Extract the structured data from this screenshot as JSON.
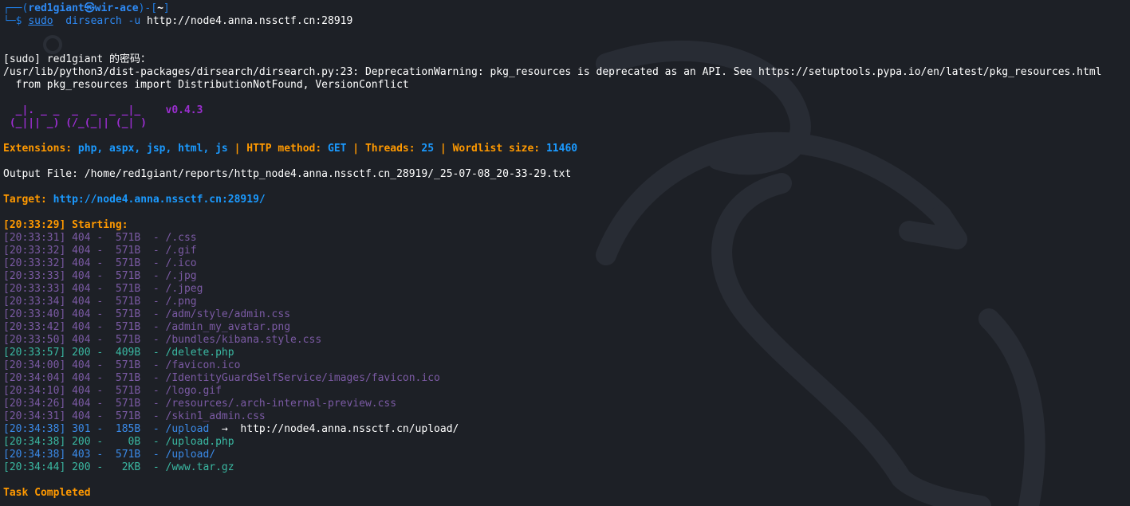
{
  "prompt": {
    "open": "┌──(",
    "user": "red1giant",
    "at": "㉿",
    "host": "wir-ace",
    "mid": ")-[",
    "dir": "~",
    "close": "]",
    "dollar": "└─$ ",
    "sudo": "sudo",
    "cmd": "  dirsearch",
    "flag": " -u ",
    "url": "http://node4.anna.nssctf.cn:28919"
  },
  "sudo_prompt": "[sudo] red1giant 的密码：",
  "warning_line1": "/usr/lib/python3/dist-packages/dirsearch/dirsearch.py:23: DeprecationWarning: pkg_resources is deprecated as an API. See https://setuptools.pypa.io/en/latest/pkg_resources.html",
  "warning_line2": "  from pkg_resources import DistributionNotFound, VersionConflict",
  "banner": {
    "line1": "  _|. _ _  _  _  _ _|_    v0.4.3",
    "line2": " (_||| _) (/_(_|| (_| )"
  },
  "config": {
    "ext_label": "Extensions: ",
    "ext_value": "php, aspx, jsp, html, js",
    "sep1": " | ",
    "method_label": "HTTP method: ",
    "method_value": "GET",
    "sep2": " | ",
    "threads_label": "Threads: ",
    "threads_value": "25",
    "sep3": " | ",
    "wordlist_label": "Wordlist size: ",
    "wordlist_value": "11460"
  },
  "output_file": "Output File: /home/red1giant/reports/http_node4.anna.nssctf.cn_28919/_25-07-08_20-33-29.txt",
  "target": {
    "label": "Target: ",
    "url": "http://node4.anna.nssctf.cn:28919/"
  },
  "starting": "[20:33:29] Starting:",
  "results": [
    {
      "time": "[20:33:31]",
      "code": "404",
      "size": "571B",
      "path": "/.css",
      "kind": "404",
      "redirect": ""
    },
    {
      "time": "[20:33:32]",
      "code": "404",
      "size": "571B",
      "path": "/.gif",
      "kind": "404",
      "redirect": ""
    },
    {
      "time": "[20:33:32]",
      "code": "404",
      "size": "571B",
      "path": "/.ico",
      "kind": "404",
      "redirect": ""
    },
    {
      "time": "[20:33:33]",
      "code": "404",
      "size": "571B",
      "path": "/.jpg",
      "kind": "404",
      "redirect": ""
    },
    {
      "time": "[20:33:33]",
      "code": "404",
      "size": "571B",
      "path": "/.jpeg",
      "kind": "404",
      "redirect": ""
    },
    {
      "time": "[20:33:34]",
      "code": "404",
      "size": "571B",
      "path": "/.png",
      "kind": "404",
      "redirect": ""
    },
    {
      "time": "[20:33:40]",
      "code": "404",
      "size": "571B",
      "path": "/adm/style/admin.css",
      "kind": "404",
      "redirect": ""
    },
    {
      "time": "[20:33:42]",
      "code": "404",
      "size": "571B",
      "path": "/admin_my_avatar.png",
      "kind": "404",
      "redirect": ""
    },
    {
      "time": "[20:33:50]",
      "code": "404",
      "size": "571B",
      "path": "/bundles/kibana.style.css",
      "kind": "404",
      "redirect": ""
    },
    {
      "time": "[20:33:57]",
      "code": "200",
      "size": "409B",
      "path": "/delete.php",
      "kind": "200",
      "redirect": ""
    },
    {
      "time": "[20:34:00]",
      "code": "404",
      "size": "571B",
      "path": "/favicon.ico",
      "kind": "404",
      "redirect": ""
    },
    {
      "time": "[20:34:04]",
      "code": "404",
      "size": "571B",
      "path": "/IdentityGuardSelfService/images/favicon.ico",
      "kind": "404",
      "redirect": ""
    },
    {
      "time": "[20:34:10]",
      "code": "404",
      "size": "571B",
      "path": "/logo.gif",
      "kind": "404",
      "redirect": ""
    },
    {
      "time": "[20:34:26]",
      "code": "404",
      "size": "571B",
      "path": "/resources/.arch-internal-preview.css",
      "kind": "404",
      "redirect": ""
    },
    {
      "time": "[20:34:31]",
      "code": "404",
      "size": "571B",
      "path": "/skin1_admin.css",
      "kind": "404",
      "redirect": ""
    },
    {
      "time": "[20:34:38]",
      "code": "301",
      "size": "185B",
      "path": "/upload",
      "kind": "301",
      "redirect": "  ->  http://node4.anna.nssctf.cn/upload/"
    },
    {
      "time": "[20:34:38]",
      "code": "200",
      "size": "0B",
      "path": "/upload.php",
      "kind": "200",
      "redirect": ""
    },
    {
      "time": "[20:34:38]",
      "code": "403",
      "size": "571B",
      "path": "/upload/",
      "kind": "301",
      "redirect": ""
    },
    {
      "time": "[20:34:44]",
      "code": "200",
      "size": "2KB",
      "path": "/www.tar.gz",
      "kind": "200",
      "redirect": ""
    }
  ],
  "task_completed": "Task Completed",
  "colors": {
    "background": "#1d2026",
    "prompt_blue": "#2e8af5",
    "orange": "#ff9900",
    "value_blue": "#1b9aff",
    "status_404": "#7b5aa4",
    "status_200": "#3ab8a2",
    "status_301": "#3a8ae8",
    "banner_purple": "#9b2ed0"
  }
}
